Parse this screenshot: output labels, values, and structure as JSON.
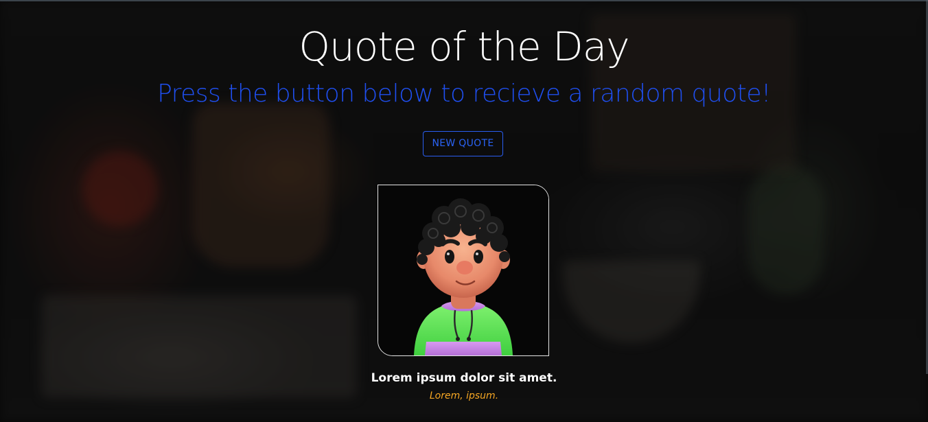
{
  "header": {
    "title": "Quote of the Day",
    "subtitle": "Press the button below to recieve a random quote!"
  },
  "actions": {
    "new_quote_label": "NEW QUOTE"
  },
  "quote": {
    "text": "Lorem ipsum dolor sit amet.",
    "author": "Lorem, ipsum."
  },
  "avatar": {
    "icon": "cartoon-boy-avatar"
  },
  "colors": {
    "title": "#ffffff",
    "subtitle": "#1f4ff0",
    "button": "#2a5ef2",
    "author": "#f5a623",
    "hoodie_green": "#5ee85a",
    "hoodie_purple": "#c884e8"
  }
}
